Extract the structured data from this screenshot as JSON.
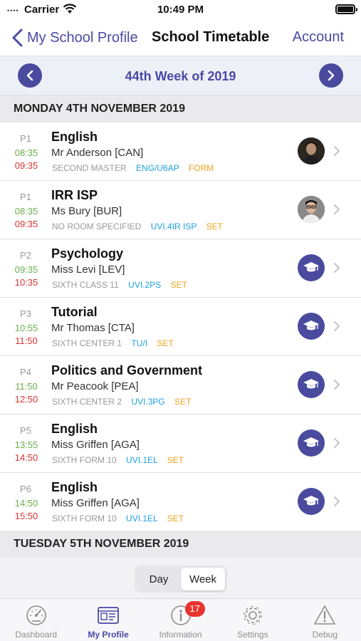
{
  "status_bar": {
    "signal": "••••",
    "carrier": "Carrier",
    "time": "10:49 PM"
  },
  "nav": {
    "back_label": "My School Profile",
    "title": "School Timetable",
    "account_label": "Account"
  },
  "week": {
    "label": "44th Week of 2019"
  },
  "days": [
    {
      "header": "MONDAY 4TH NOVEMBER 2019",
      "lessons": [
        {
          "period": "P1",
          "start": "08:35",
          "end": "09:35",
          "subject": "English",
          "teacher": "Mr Anderson [CAN]",
          "room": "SECOND MASTER",
          "group": "ENG/U6AP",
          "type": "FORM",
          "avatar": "teacher-photo"
        },
        {
          "period": "P1",
          "start": "08:35",
          "end": "09:35",
          "subject": "IRR ISP",
          "teacher": "Ms Bury [BUR]",
          "room": "NO ROOM SPECIFIED",
          "group": "UVI.4IR ISP",
          "type": "SET",
          "avatar": "teacher-photo"
        },
        {
          "period": "P2",
          "start": "09:35",
          "end": "10:35",
          "subject": "Psychology",
          "teacher": "Miss Levi [LEV]",
          "room": "SIXTH CLASS 11",
          "group": "UVI.2PS",
          "type": "SET",
          "avatar": "graduation-cap-icon"
        },
        {
          "period": "P3",
          "start": "10:55",
          "end": "11:50",
          "subject": "Tutorial",
          "teacher": "Mr Thomas [CTA]",
          "room": "SIXTH CENTER 1",
          "group": "TU/I",
          "type": "SET",
          "avatar": "graduation-cap-icon"
        },
        {
          "period": "P4",
          "start": "11:50",
          "end": "12:50",
          "subject": "Politics and Government",
          "teacher": "Mr Peacook [PEA]",
          "room": "SIXTH CENTER 2",
          "group": "UVI.3PG",
          "type": "SET",
          "avatar": "graduation-cap-icon"
        },
        {
          "period": "P5",
          "start": "13:55",
          "end": "14:50",
          "subject": "English",
          "teacher": "Miss Griffen [AGA]",
          "room": "SIXTH FORM 10",
          "group": "UVI.1EL",
          "type": "SET",
          "avatar": "graduation-cap-icon"
        },
        {
          "period": "P6",
          "start": "14:50",
          "end": "15:50",
          "subject": "English",
          "teacher": "Miss Griffen [AGA]",
          "room": "SIXTH FORM 10",
          "group": "UVI.1EL",
          "type": "SET",
          "avatar": "graduation-cap-icon"
        }
      ]
    },
    {
      "header": "TUESDAY 5TH NOVEMBER 2019",
      "lessons": []
    }
  ],
  "segment": {
    "day_label": "Day",
    "week_label": "Week",
    "selected": "Week"
  },
  "tab_bar": {
    "items": [
      {
        "label": "Dashboard",
        "icon": "speedometer-icon"
      },
      {
        "label": "My Profile",
        "icon": "profile-card-icon",
        "active": true
      },
      {
        "label": "Information",
        "icon": "info-icon",
        "badge": "17"
      },
      {
        "label": "Settings",
        "icon": "gear-icon"
      },
      {
        "label": "Debug",
        "icon": "warning-icon"
      }
    ]
  },
  "colors": {
    "accent": "#4b49a6",
    "start_time": "#6ab04c",
    "end_time": "#dd3333",
    "group": "#1da1e0",
    "set": "#f0a21c",
    "badge": "#e8342f"
  }
}
